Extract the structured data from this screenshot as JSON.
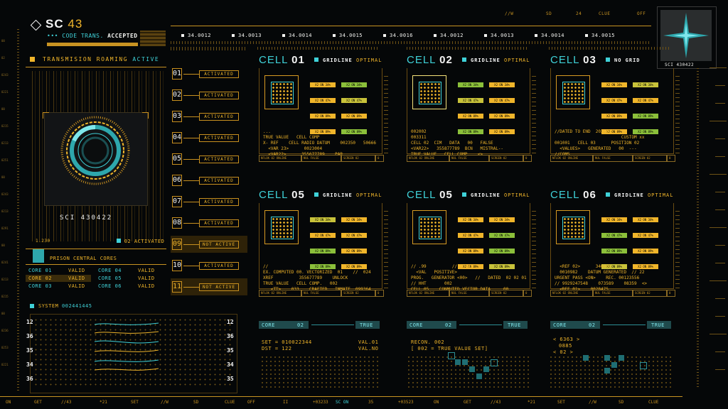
{
  "header": {
    "sc_label": "SC",
    "sc_number": "43",
    "code_dots": "•••",
    "code_trans": "CODE TRANS.",
    "accepted": "ACCEPTED",
    "values": [
      "34.0012",
      "34.0013",
      "34.0014",
      "34.0015",
      "34.0016",
      "34.0012",
      "34.0013",
      "34.0014",
      "34.0015"
    ],
    "top_right": [
      "//W",
      "SD",
      "24",
      "CLUE",
      "OFF"
    ]
  },
  "left_panel": {
    "status_label": "TRANSMISION ROAMING",
    "status_value": "ACTIVE",
    "reactor_id": "SCI  430422",
    "activated_count": "02",
    "activated_label": "ACTIVATED",
    "small_readout": "1.230",
    "cores_title": "PRISON CENTRAL CORES",
    "cores": [
      {
        "name": "CORE 01",
        "status": "VALID"
      },
      {
        "name": "CORE 02",
        "status": "VALID"
      },
      {
        "name": "CORE 03",
        "status": "VALID"
      },
      {
        "name": "CORE 04",
        "status": "VALID"
      },
      {
        "name": "CORE 05",
        "status": "VALID"
      },
      {
        "name": "CORE 06",
        "status": "VALID"
      }
    ],
    "system_label": "SYSTEM",
    "system_value": "002441445"
  },
  "left_scale": [
    "00",
    "02",
    "0243",
    "0221",
    "00",
    "0215",
    "0213",
    "0251",
    "00",
    "0243",
    "0213",
    "0291",
    "00",
    "0241",
    "0213",
    "0215",
    "00",
    "0236",
    "0253",
    "0221"
  ],
  "module_list": [
    {
      "num": "01",
      "status": "ACTIVATED"
    },
    {
      "num": "02",
      "status": "ACTIVATED"
    },
    {
      "num": "03",
      "status": "ACTIVATED"
    },
    {
      "num": "04",
      "status": "ACTIVATED"
    },
    {
      "num": "05",
      "status": "ACTIVATED"
    },
    {
      "num": "06",
      "status": "ACTIVATED"
    },
    {
      "num": "07",
      "status": "ACTIVATED"
    },
    {
      "num": "08",
      "status": "ACTIVATED"
    },
    {
      "num": "09",
      "status": "NOT ACTIVE"
    },
    {
      "num": "10",
      "status": "ACTIVATED"
    },
    {
      "num": "11",
      "status": "NOT ACTIVE"
    }
  ],
  "cells": [
    {
      "label": "CELL",
      "num": "01",
      "status_key": "GRIDLINE",
      "status_val": "OPTIMAL",
      "text": "...\nTRUE VALUE   CELL COMP\nX- REF    CELL RADIO DATUM    002350   50666\n  <VAR 23>      0023004\n  <VAR22>      355677789    PAR"
    },
    {
      "label": "CELL",
      "num": "02",
      "status_key": "GRIDLINE",
      "status_val": "OPTIMAL",
      "text": "002002\n003311\nCELL 02  CIM   DATA   00   FALSE\n<VAR22>   355877789  BCN   MISTRAL--\nTRUE VALUE   CELL COMP    <>"
    },
    {
      "label": "CELL",
      "num": "03",
      "status_key": "NO GRID",
      "status_val": "",
      "text": "//DATED TO END  202021\n                          CUSTOM xx\n001001   CELL 03      POSITION 02\n  <VALUES>   GENERATED   00  ---\n//COMS"
    },
    {
      "label": "CELL",
      "num": "05",
      "status_key": "GRIDLINE",
      "status_val": "OPTIMAL",
      "text": "//\nEX. COMPUTED 00. VECTORIZED  01    //  024\nXREF          355677789    UNLOCK\nTRUE VALUE   CELL COMP.   002\n   <TT>    033    CRAFTED   INMATE  099364"
    },
    {
      "label": "CELL",
      "num": "05",
      "status_key": "GRIDLINE",
      "status_val": "OPTIMAL",
      "text": "// .99          //   .91\n  <VAL   POSITIVE>\nPROG.   GENERATOR <00>   //   DATED  02 02 01\n// HHT       002\nCELL 05    CONMUTED VECTOR DATA     00"
    },
    {
      "label": "CELL",
      "num": "06",
      "status_key": "GRIDLINE",
      "status_val": "OPTIMAL",
      "text": "  <REF 02>      346655\n  0010982    DATUM GENERATED  // 22\nURGENT PASS <ON>    REC. 00123556\n// 9929247548    073589    08359  <>\n  <REF 01>    0028475"
    }
  ],
  "cell_foot": [
    "NFLOK 02 ONLINE",
    "NUL FALSE",
    "SCREEN  02",
    "0"
  ],
  "bars": [
    "X2 ON 34%",
    "X2 ON 34%",
    "X2 ON 47%",
    "X2 ON 47%",
    "X2 ON 89%",
    "X2 ON 89%",
    "X2 ON 89%",
    "X2 ON 89%"
  ],
  "bottom_cores": [
    {
      "label": "CORE",
      "num": "02",
      "state": "TRUE"
    },
    {
      "label": "CORE",
      "num": "02",
      "state": "TRUE"
    },
    {
      "label": "CORE",
      "num": "02",
      "state": "TRUE"
    }
  ],
  "bottom_texts": {
    "a1": "SET = 010022344",
    "a2": "DST = 122",
    "a3": "VAL.01",
    "a4": "VAL.NO",
    "b1": "RECON. 002",
    "b2": "[ 002 = TRUE VALUE SET]",
    "c1": "< 6363 >",
    "c2": "0885",
    "c3": "< 02 >"
  },
  "graph_left_nums": [
    "12",
    "36",
    "35",
    "34",
    "36"
  ],
  "graph_right_nums": [
    "12",
    "36",
    "35",
    "34",
    "35"
  ],
  "badge_id": "SCI  430422",
  "footer": [
    "ON",
    "GET",
    "//43",
    "*21",
    "SET",
    "//W",
    "SD",
    "CLUE",
    "OFF",
    "II",
    "+03233",
    "SC ON",
    "35",
    "+03523",
    "ON",
    "GET",
    "//43",
    "*21",
    "SET",
    "//W",
    "SD",
    "CLUE"
  ],
  "colors": {
    "amber": "#f0b52a",
    "cyan": "#3fd1d8",
    "bg": "#050708"
  }
}
